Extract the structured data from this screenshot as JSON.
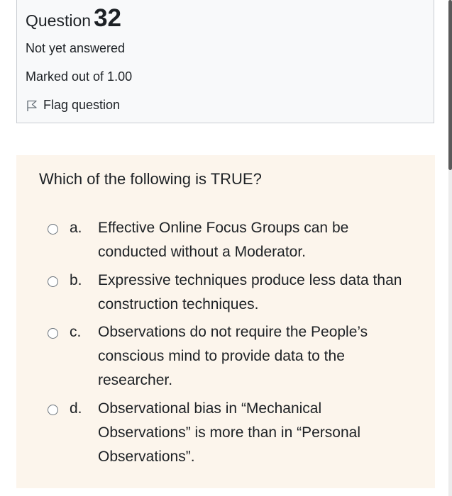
{
  "info": {
    "question_label": "Question",
    "question_number": "32",
    "state": "Not yet answered",
    "grade": "Marked out of 1.00",
    "flag_label": "Flag question"
  },
  "question": {
    "text": "Which of the following is TRUE?",
    "answers": [
      {
        "letter": "a.",
        "text": "Effective Online Focus Groups can be conducted without a Moderator.",
        "selected": false
      },
      {
        "letter": "b.",
        "text": "Expressive techniques produce less data than construction techniques.",
        "selected": false
      },
      {
        "letter": "c.",
        "text": "Observations do not require the People’s conscious mind to provide data to the researcher.",
        "selected": false
      },
      {
        "letter": "d.",
        "text": "Observational bias in “Mechanical Observations” is more than in “Personal Observations”.",
        "selected": false
      }
    ]
  },
  "colors": {
    "info_background": "#f8f9fa",
    "formulation_background": "#fcf5ec",
    "text": "#1d2125",
    "radio_border": "#6a737b"
  },
  "icons": {
    "flag": "flag-outline-icon",
    "radio": "radio-unchecked-icon"
  }
}
